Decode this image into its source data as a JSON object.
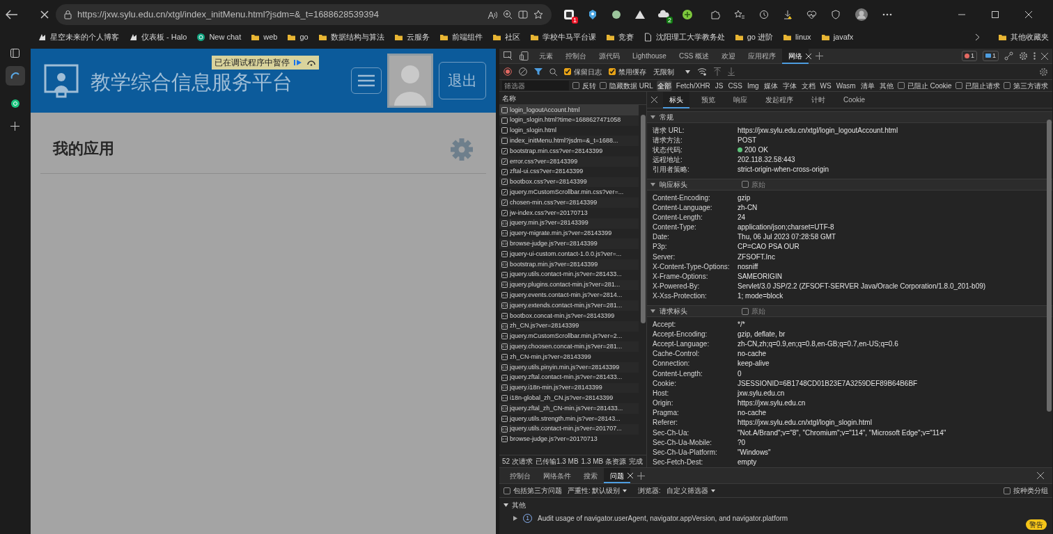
{
  "browser": {
    "url": "https://jxw.sylu.edu.cn/xtgl/index_initMenu.html?jsdm=&_t=1688628539394",
    "extensions": [
      {
        "kind": "square",
        "badge": "1",
        "color": "#e81123"
      },
      {
        "kind": "bug"
      },
      {
        "kind": "circle"
      },
      {
        "kind": "mountain"
      },
      {
        "kind": "cloud",
        "badge": "2",
        "color": "#107c10"
      },
      {
        "kind": "plus"
      }
    ],
    "bookmarks": [
      {
        "label": "星空未来的个人博客",
        "kind": "site"
      },
      {
        "label": "仪表板 - Halo",
        "kind": "site"
      },
      {
        "label": "New chat",
        "kind": "chat"
      },
      {
        "label": "web",
        "kind": "folder"
      },
      {
        "label": "go",
        "kind": "folder"
      },
      {
        "label": "数据结构与算法",
        "kind": "folder"
      },
      {
        "label": "云服务",
        "kind": "folder"
      },
      {
        "label": "前端组件",
        "kind": "folder"
      },
      {
        "label": "社区",
        "kind": "folder"
      },
      {
        "label": "学校牛马平台课",
        "kind": "folder"
      },
      {
        "label": "竞赛",
        "kind": "folder"
      },
      {
        "label": "沈阳理工大学教务处",
        "kind": "page"
      },
      {
        "label": "go 进阶",
        "kind": "folder"
      },
      {
        "label": "linux",
        "kind": "folder"
      },
      {
        "label": "javafx",
        "kind": "folder"
      }
    ],
    "other_bookmarks": "其他收藏夹"
  },
  "page": {
    "title": "教学综合信息服务平台",
    "logout": "退出",
    "paused_banner": "已在调试程序中暂停",
    "section_title": "我的应用"
  },
  "devtools": {
    "tabs": [
      {
        "label": "元素",
        "selected": false
      },
      {
        "label": "控制台",
        "selected": false
      },
      {
        "label": "源代码",
        "selected": false
      },
      {
        "label": "Lighthouse",
        "selected": false
      },
      {
        "label": "CSS 概述",
        "selected": false
      },
      {
        "label": "欢迎",
        "selected": false
      },
      {
        "label": "应用程序",
        "selected": false
      },
      {
        "label": "网络",
        "selected": true
      }
    ],
    "error_count": "1",
    "info_count": "1",
    "toolbar": {
      "preserve_log": {
        "label": "保留日志",
        "checked": true
      },
      "disable_cache": {
        "label": "禁用缓存",
        "checked": true
      },
      "throttling": "无限制"
    },
    "filter": {
      "placeholder": "筛选器",
      "invert": {
        "label": "反转",
        "checked": false
      },
      "hide_data_urls": {
        "label": "隐藏数据 URL",
        "checked": false
      },
      "types": [
        {
          "label": "全部",
          "selected": true
        },
        {
          "label": "Fetch/XHR",
          "selected": false
        },
        {
          "label": "JS",
          "selected": false
        },
        {
          "label": "CSS",
          "selected": false
        },
        {
          "label": "Img",
          "selected": false
        },
        {
          "label": "媒体",
          "selected": false
        },
        {
          "label": "字体",
          "selected": false
        },
        {
          "label": "文档",
          "selected": false
        },
        {
          "label": "WS",
          "selected": false
        },
        {
          "label": "Wasm",
          "selected": false
        },
        {
          "label": "清单",
          "selected": false
        },
        {
          "label": "其他",
          "selected": false
        }
      ],
      "blocked_cookies": {
        "label": "已阻止 Cookie",
        "checked": false
      },
      "blocked_requests": {
        "label": "已阻止请求",
        "checked": false
      },
      "third_party": {
        "label": "第三方请求",
        "checked": false
      }
    },
    "request_list": {
      "column": "名称",
      "requests": [
        {
          "name": "login_logoutAccount.html",
          "kind": "doc",
          "selected": true
        },
        {
          "name": "login_slogin.html?time=1688627471058",
          "kind": "doc",
          "selected": false
        },
        {
          "name": "login_slogin.html",
          "kind": "doc",
          "selected": false
        },
        {
          "name": "index_initMenu.html?jsdm=&_t=1688...",
          "kind": "doc",
          "selected": false
        },
        {
          "name": "bootstrap.min.css?ver=28143399",
          "kind": "css",
          "selected": false
        },
        {
          "name": "error.css?ver=28143399",
          "kind": "css",
          "selected": false
        },
        {
          "name": "zftal-ui.css?ver=28143399",
          "kind": "css",
          "selected": false
        },
        {
          "name": "bootbox.css?ver=28143399",
          "kind": "css",
          "selected": false
        },
        {
          "name": "jquery.mCustomScrollbar.min.css?ver=...",
          "kind": "css",
          "selected": false
        },
        {
          "name": "chosen-min.css?ver=28143399",
          "kind": "css",
          "selected": false
        },
        {
          "name": "jw-index.css?ver=20170713",
          "kind": "css",
          "selected": false
        },
        {
          "name": "jquery.min.js?ver=28143399",
          "kind": "js",
          "selected": false
        },
        {
          "name": "jquery-migrate.min.js?ver=28143399",
          "kind": "js",
          "selected": false
        },
        {
          "name": "browse-judge.js?ver=28143399",
          "kind": "js",
          "selected": false
        },
        {
          "name": "jquery-ui-custom.contact-1.0.0.js?ver=...",
          "kind": "js",
          "selected": false
        },
        {
          "name": "bootstrap.min.js?ver=28143399",
          "kind": "js",
          "selected": false
        },
        {
          "name": "jquery.utils.contact-min.js?ver=281433...",
          "kind": "js",
          "selected": false
        },
        {
          "name": "jquery.plugins.contact-min.js?ver=281...",
          "kind": "js",
          "selected": false
        },
        {
          "name": "jquery.events.contact-min.js?ver=2814...",
          "kind": "js",
          "selected": false
        },
        {
          "name": "jquery.extends.contact-min.js?ver=281...",
          "kind": "js",
          "selected": false
        },
        {
          "name": "bootbox.concat-min.js?ver=28143399",
          "kind": "js",
          "selected": false
        },
        {
          "name": "zh_CN.js?ver=28143399",
          "kind": "js",
          "selected": false
        },
        {
          "name": "jquery.mCustomScrollbar.min.js?ver=2...",
          "kind": "js",
          "selected": false
        },
        {
          "name": "jquery.choosen.concat-min.js?ver=281...",
          "kind": "js",
          "selected": false
        },
        {
          "name": "zh_CN-min.js?ver=28143399",
          "kind": "js",
          "selected": false
        },
        {
          "name": "jquery.utils.pinyin.min.js?ver=28143399",
          "kind": "js",
          "selected": false
        },
        {
          "name": "jquery.zftal.contact-min.js?ver=281433...",
          "kind": "js",
          "selected": false
        },
        {
          "name": "jquery.i18n-min.js?ver=28143399",
          "kind": "js",
          "selected": false
        },
        {
          "name": "i18n-global_zh_CN.js?ver=28143399",
          "kind": "js",
          "selected": false
        },
        {
          "name": "jquery.zftal_zh_CN-min.js?ver=281433...",
          "kind": "js",
          "selected": false
        },
        {
          "name": "jquery.utils.strength.min.js?ver=28143...",
          "kind": "js",
          "selected": false
        },
        {
          "name": "jquery.utils.contact-min.js?ver=201707...",
          "kind": "js",
          "selected": false
        },
        {
          "name": "browse-judge.js?ver=20170713",
          "kind": "js",
          "selected": false
        }
      ],
      "summary": [
        "52 次请求",
        "已传输1.3 MB",
        "1.3 MB 条资源",
        "完成"
      ]
    },
    "detail_tabs": [
      {
        "label": "标头",
        "selected": true
      },
      {
        "label": "预览",
        "selected": false
      },
      {
        "label": "响应",
        "selected": false
      },
      {
        "label": "发起程序",
        "selected": false
      },
      {
        "label": "计时",
        "selected": false
      },
      {
        "label": "Cookie",
        "selected": false
      }
    ],
    "sections": [
      {
        "title": "常规",
        "expanded": true,
        "rows": [
          {
            "name": "请求 URL:",
            "value": "https://jxw.sylu.edu.cn/xtgl/login_logoutAccount.html"
          },
          {
            "name": "请求方法:",
            "value": "POST"
          },
          {
            "name": "状态代码:",
            "value": "200 OK",
            "kind": "status"
          },
          {
            "name": "远程地址:",
            "value": "202.118.32.58:443"
          },
          {
            "name": "引用者策略:",
            "value": "strict-origin-when-cross-origin"
          }
        ]
      },
      {
        "title": "响应标头",
        "expanded": true,
        "raw": {
          "label": "原始",
          "checked": false
        },
        "rows": [
          {
            "name": "Content-Encoding:",
            "value": "gzip"
          },
          {
            "name": "Content-Language:",
            "value": "zh-CN"
          },
          {
            "name": "Content-Length:",
            "value": "24"
          },
          {
            "name": "Content-Type:",
            "value": "application/json;charset=UTF-8"
          },
          {
            "name": "Date:",
            "value": "Thu, 06 Jul 2023 07:28:58 GMT"
          },
          {
            "name": "P3p:",
            "value": "CP=CAO PSA OUR"
          },
          {
            "name": "Server:",
            "value": "ZFSOFT.Inc"
          },
          {
            "name": "X-Content-Type-Options:",
            "value": "nosniff"
          },
          {
            "name": "X-Frame-Options:",
            "value": "SAMEORIGIN"
          },
          {
            "name": "X-Powered-By:",
            "value": "Servlet/3.0 JSP/2.2 (ZFSOFT-SERVER Java/Oracle Corporation/1.8.0_201-b09)"
          },
          {
            "name": "X-Xss-Protection:",
            "value": "1; mode=block"
          }
        ]
      },
      {
        "title": "请求标头",
        "expanded": true,
        "raw": {
          "label": "原始",
          "checked": false
        },
        "rows": [
          {
            "name": "Accept:",
            "value": "*/*"
          },
          {
            "name": "Accept-Encoding:",
            "value": "gzip, deflate, br"
          },
          {
            "name": "Accept-Language:",
            "value": "zh-CN,zh;q=0.9,en;q=0.8,en-GB;q=0.7,en-US;q=0.6"
          },
          {
            "name": "Cache-Control:",
            "value": "no-cache"
          },
          {
            "name": "Connection:",
            "value": "keep-alive"
          },
          {
            "name": "Content-Length:",
            "value": "0"
          },
          {
            "name": "Cookie:",
            "value": "JSESSIONID=6B1748CD01B23E7A3259DEF89B64B6BF"
          },
          {
            "name": "Host:",
            "value": "jxw.sylu.edu.cn"
          },
          {
            "name": "Origin:",
            "value": "https://jxw.sylu.edu.cn"
          },
          {
            "name": "Pragma:",
            "value": "no-cache"
          },
          {
            "name": "Referer:",
            "value": "https://jxw.sylu.edu.cn/xtgl/login_slogin.html"
          },
          {
            "name": "Sec-Ch-Ua:",
            "value": "\"Not.A/Brand\";v=\"8\", \"Chromium\";v=\"114\", \"Microsoft Edge\";v=\"114\""
          },
          {
            "name": "Sec-Ch-Ua-Mobile:",
            "value": "?0"
          },
          {
            "name": "Sec-Ch-Ua-Platform:",
            "value": "\"Windows\""
          },
          {
            "name": "Sec-Fetch-Dest:",
            "value": "empty"
          }
        ]
      }
    ],
    "drawer": {
      "tabs": [
        {
          "label": "控制台",
          "selected": false
        },
        {
          "label": "网络条件",
          "selected": false
        },
        {
          "label": "搜索",
          "selected": false
        },
        {
          "label": "问题",
          "selected": true
        }
      ],
      "include_third_party": {
        "label": "包括第三方问题",
        "checked": false
      },
      "severity_label": "严重性:",
      "severity": "默认级别",
      "browser_label": "浏览器:",
      "browser_filter": "自定义筛选器",
      "group_by_kind": {
        "label": "按种类分组",
        "checked": false
      },
      "groups": [
        {
          "title": "其他",
          "expanded": true,
          "issues": [
            {
              "count": "1",
              "text": "Audit usage of navigator.userAgent, navigator.appVersion, and navigator.platform",
              "expanded": false
            }
          ]
        }
      ],
      "warning_badge": "警告"
    }
  }
}
